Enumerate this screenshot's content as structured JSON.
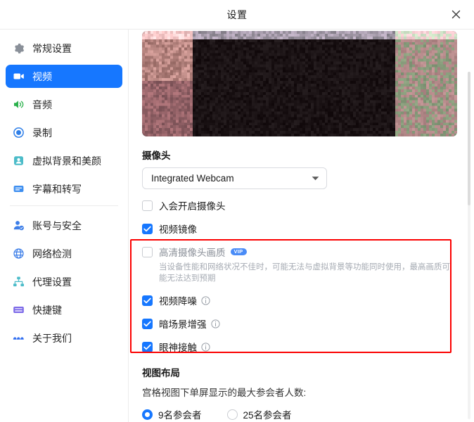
{
  "window": {
    "title": "设置",
    "close_label": "×"
  },
  "sidebar": {
    "items": [
      {
        "label": "常规设置",
        "icon": "gear-icon",
        "active": false
      },
      {
        "label": "视频",
        "icon": "video-camera-icon",
        "active": true
      },
      {
        "label": "音频",
        "icon": "speaker-icon",
        "active": false
      },
      {
        "label": "录制",
        "icon": "record-circle-icon",
        "active": false
      },
      {
        "label": "虚拟背景和美颜",
        "icon": "person-card-icon",
        "active": false
      },
      {
        "label": "字幕和转写",
        "icon": "caption-icon",
        "active": false
      },
      {
        "label": "账号与安全",
        "icon": "account-security-icon",
        "active": false
      },
      {
        "label": "网络检测",
        "icon": "globe-icon",
        "active": false
      },
      {
        "label": "代理设置",
        "icon": "sitemap-icon",
        "active": false
      },
      {
        "label": "快捷键",
        "icon": "keyboard-icon",
        "active": false
      },
      {
        "label": "关于我们",
        "icon": "about-logo-icon",
        "active": false
      }
    ]
  },
  "main": {
    "camera_section": {
      "title": "摄像头",
      "device_select": {
        "value": "Integrated Webcam",
        "caret_icon": "chevron-down-icon"
      },
      "options": [
        {
          "label": "入会开启摄像头",
          "checked": false,
          "dim": false,
          "vip": false,
          "info": false,
          "hint": ""
        },
        {
          "label": "视频镜像",
          "checked": true,
          "dim": false,
          "vip": false,
          "info": false,
          "hint": ""
        },
        {
          "label": "高清摄像头画质",
          "checked": false,
          "dim": true,
          "vip": true,
          "vip_text": "VIP",
          "info": false,
          "hint": "当设备性能和网络状况不佳时，可能无法与虚拟背景等功能同时使用，最高画质可能无法达到预期"
        },
        {
          "label": "视频降噪",
          "checked": true,
          "dim": false,
          "vip": false,
          "info": true,
          "hint": ""
        },
        {
          "label": "暗场景增强",
          "checked": true,
          "dim": false,
          "vip": false,
          "info": true,
          "hint": ""
        },
        {
          "label": "眼神接触",
          "checked": true,
          "dim": false,
          "vip": false,
          "info": true,
          "hint": ""
        }
      ]
    },
    "layout_section": {
      "title": "视图布局",
      "subtitle": "宫格视图下单屏显示的最大参会者人数:",
      "radios": [
        {
          "label": "9名参会者",
          "checked": true
        },
        {
          "label": "25名参会者",
          "checked": false
        }
      ]
    },
    "highlight_color": "#fb0000",
    "accent_color": "#1677ff"
  }
}
